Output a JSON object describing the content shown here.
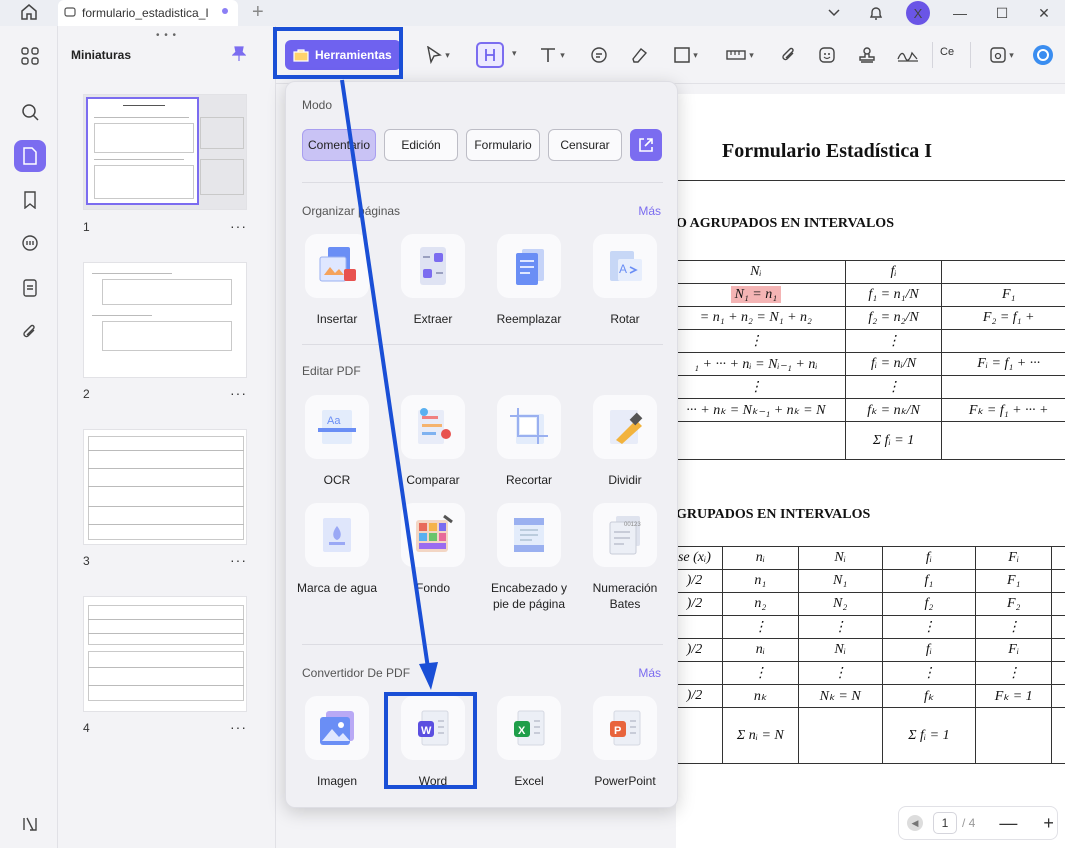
{
  "titlebar": {
    "tab_title": "formulario_estadistica_I",
    "add_tab": "+",
    "avatar": "X",
    "min": "—",
    "max": "☐",
    "close": "✕"
  },
  "thumbnails": {
    "title": "Miniaturas",
    "pages": [
      "1",
      "2",
      "3",
      "4"
    ],
    "more": "···"
  },
  "toolbar": {
    "tools_label": "Herramientas",
    "cut_label": "Ce"
  },
  "popup": {
    "mode_title": "Modo",
    "modes": [
      "Comentario",
      "Edición",
      "Formulario",
      "Censurar"
    ],
    "organize_title": "Organizar páginas",
    "organize_more": "Más",
    "organize": [
      "Insertar",
      "Extraer",
      "Reemplazar",
      "Rotar"
    ],
    "edit_title": "Editar PDF",
    "edit": [
      "OCR",
      "Comparar",
      "Recortar",
      "Dividir",
      "Marca de agua",
      "Fondo",
      "Encabezado y pie de página",
      "Numeración Bates"
    ],
    "convert_title": "Convertidor De PDF",
    "convert_more": "Más",
    "convert": [
      "Imagen",
      "Word",
      "Excel",
      "PowerPoint"
    ]
  },
  "document": {
    "title": "Formulario Estadística I",
    "section1": "O AGRUPADOS EN INTERVALOS",
    "section2": "GRUPADOS EN INTERVALOS",
    "table1": [
      [
        "Nᵢ",
        "fᵢ",
        ""
      ],
      [
        "N₁ = n₁",
        "f₁ = n₁/N",
        "F₁"
      ],
      [
        "= n₁ + n₂ = N₁ + n₂",
        "f₂ = n₂/N",
        "F₂ = f₁ +"
      ],
      [
        "⋮",
        "⋮",
        ""
      ],
      [
        "₁ + ··· + nᵢ = Nᵢ₋₁ + nᵢ",
        "fᵢ = nᵢ/N",
        "Fᵢ = f₁ + ···"
      ],
      [
        "⋮",
        "⋮",
        ""
      ],
      [
        "··· + nₖ = Nₖ₋₁ + nₖ = N",
        "fₖ = nₖ/N",
        "Fₖ = f₁ + ··· +"
      ],
      [
        "",
        "Σ fᵢ = 1",
        ""
      ]
    ],
    "table2": [
      [
        "se (xᵢ)",
        "nᵢ",
        "Nᵢ",
        "fᵢ",
        "Fᵢ"
      ],
      [
        ")/2",
        "n₁",
        "N₁",
        "f₁",
        "F₁"
      ],
      [
        ")/2",
        "n₂",
        "N₂",
        "f₂",
        "F₂"
      ],
      [
        "",
        "⋮",
        "⋮",
        "⋮",
        "⋮"
      ],
      [
        ")/2",
        "nᵢ",
        "Nᵢ",
        "fᵢ",
        "Fᵢ"
      ],
      [
        "",
        "⋮",
        "⋮",
        "⋮",
        "⋮"
      ],
      [
        ")/2",
        "nₖ",
        "Nₖ = N",
        "fₖ",
        "Fₖ = 1"
      ],
      [
        "",
        "Σ nᵢ = N",
        "",
        "Σ fᵢ = 1",
        ""
      ]
    ]
  },
  "pager": {
    "current": "1",
    "total": "/ 4",
    "minus": "—",
    "plus": "+"
  },
  "colors": {
    "accent": "#7b6cf0",
    "annotation": "#1a4fd6"
  }
}
